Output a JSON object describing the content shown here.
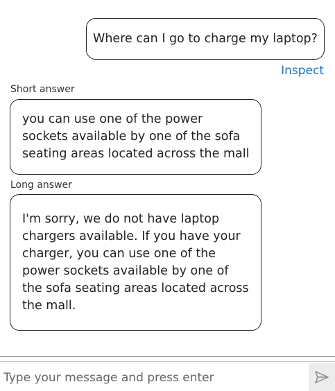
{
  "conversation": {
    "user_message": "Where can I go to charge my laptop?",
    "inspect_link": "Inspect",
    "short_answer": {
      "label": "Short answer",
      "text": "you can use one of the power sockets available by one of the sofa seating areas located across the mall"
    },
    "long_answer": {
      "label": "Long answer",
      "text": "I'm sorry, we do not have laptop chargers available. If you have your charger, you can use one of the power sockets available by one of the sofa seating areas located across the mall."
    }
  },
  "composer": {
    "placeholder": "Type your message and press enter",
    "value": "",
    "send_icon": "send-arrow-icon"
  }
}
